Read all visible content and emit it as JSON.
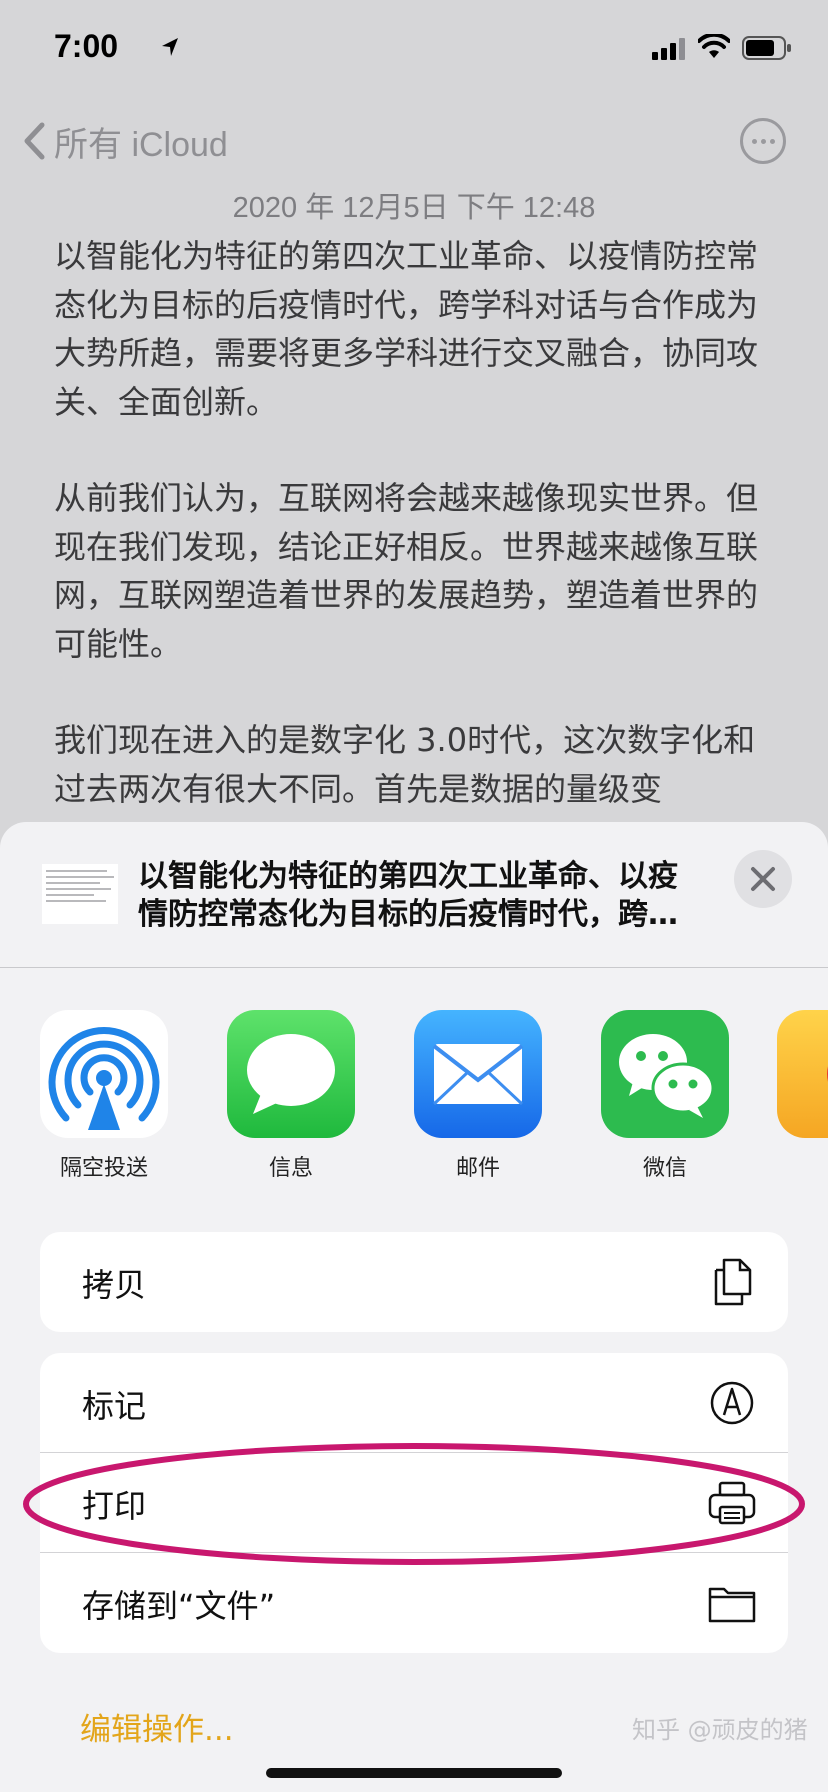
{
  "status": {
    "time": "7:00"
  },
  "nav": {
    "back_label": "所有 iCloud"
  },
  "note": {
    "date": "2020 年 12月5日 下午 12:48",
    "paragraphs": [
      "以智能化为特征的第四次工业革命、以疫情防控常态化为目标的后疫情时代，跨学科对话与合作成为大势所趋，需要将更多学科进行交叉融合，协同攻关、全面创新。",
      "从前我们认为，互联网将会越来越像现实世界。但现在我们发现，结论正好相反。世界越来越像互联网，互联网塑造着世界的发展趋势，塑造着世界的可能性。",
      "我们现在进入的是数字化 3.0时代，这次数字化和过去两次有很大不同。首先是数据的量级变"
    ]
  },
  "share": {
    "title": "以智能化为特征的第四次工业革命、以疫情防控常态化为目标的后疫情时代，跨…",
    "apps": [
      {
        "label": "隔空投送",
        "icon": "airdrop-icon"
      },
      {
        "label": "信息",
        "icon": "messages-icon"
      },
      {
        "label": "邮件",
        "icon": "mail-icon"
      },
      {
        "label": "微信",
        "icon": "wechat-icon"
      }
    ],
    "copy_label": "拷贝",
    "actions": {
      "markup": "标记",
      "print": "打印",
      "save_files": "存储到“文件”"
    },
    "edit_actions": "编辑操作..."
  },
  "watermark": "知乎 @顽皮的猪",
  "colors": {
    "accent": "#e3a51a",
    "highlight": "#c8176e",
    "messages": "#32c759",
    "mail": "#1e8cf5",
    "wechat": "#2dbb4f",
    "airdrop": "#1f84e8"
  }
}
